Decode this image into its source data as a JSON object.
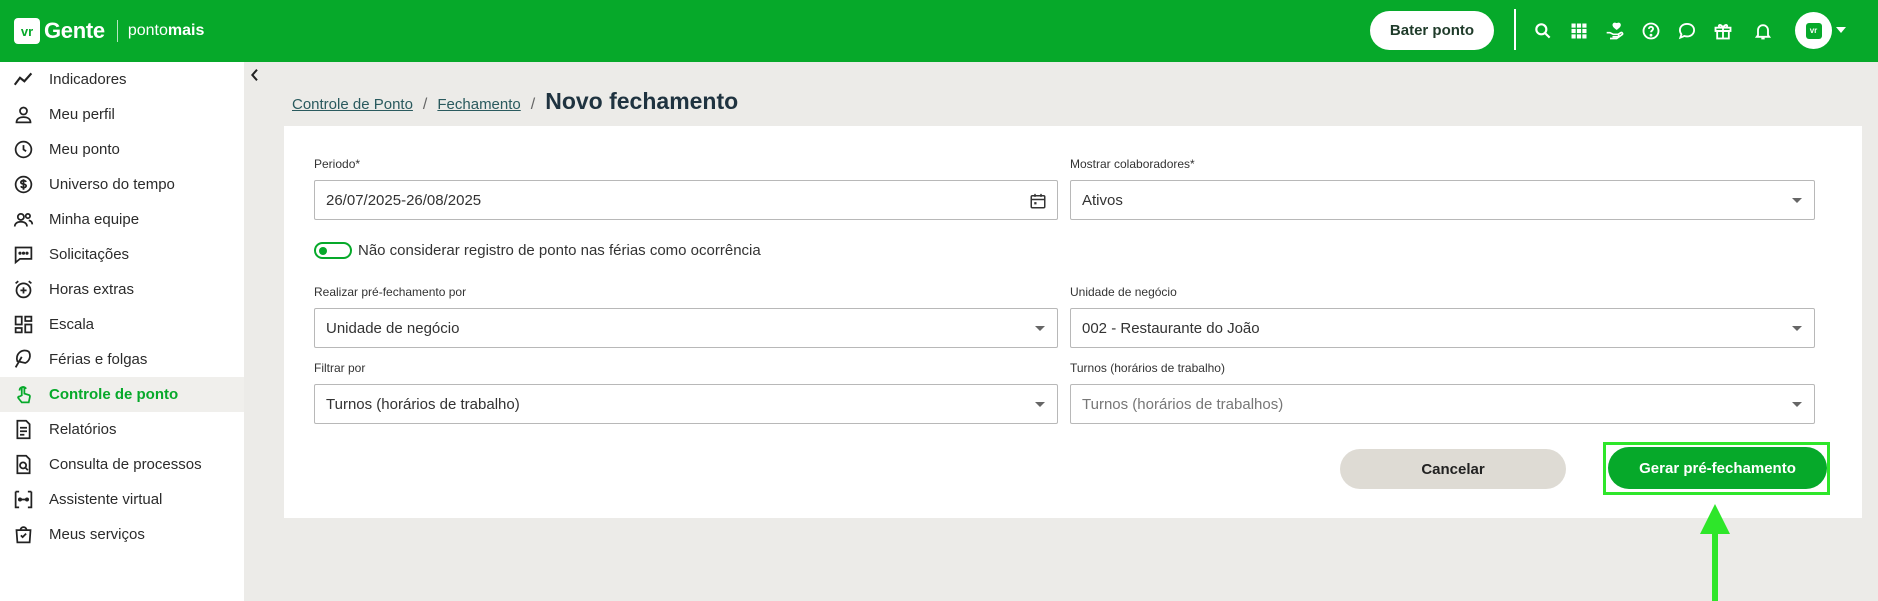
{
  "brand": {
    "badge": "vr",
    "name": "Gente",
    "product_prefix": "ponto",
    "product_suffix": "mais"
  },
  "header": {
    "clock_in_label": "Bater ponto",
    "avatar_text": "vr",
    "icons": [
      "search-icon",
      "apps-grid-icon",
      "hand-heart-icon",
      "help-icon",
      "chat-icon",
      "gift-icon",
      "bell-icon"
    ]
  },
  "sidebar": {
    "items": [
      {
        "label": "Indicadores",
        "icon": "trend-line-icon",
        "active": false
      },
      {
        "label": "Meu perfil",
        "icon": "user-icon",
        "active": false
      },
      {
        "label": "Meu ponto",
        "icon": "clock-icon",
        "active": false
      },
      {
        "label": "Universo do tempo",
        "icon": "dollar-circle-icon",
        "active": false
      },
      {
        "label": "Minha equipe",
        "icon": "team-icon",
        "active": false
      },
      {
        "label": "Solicitações",
        "icon": "message-dots-icon",
        "active": false
      },
      {
        "label": "Horas extras",
        "icon": "alarm-plus-icon",
        "active": false
      },
      {
        "label": "Escala",
        "icon": "dashboard-grid-icon",
        "active": false
      },
      {
        "label": "Férias e folgas",
        "icon": "umbrella-icon",
        "active": false
      },
      {
        "label": "Controle de ponto",
        "icon": "touch-hand-icon",
        "active": true
      },
      {
        "label": "Relatórios",
        "icon": "document-icon",
        "active": false
      },
      {
        "label": "Consulta de processos",
        "icon": "document-search-icon",
        "active": false
      },
      {
        "label": "Assistente virtual",
        "icon": "bot-icon",
        "active": false
      },
      {
        "label": "Meus serviços",
        "icon": "shopping-bag-icon",
        "active": false
      }
    ]
  },
  "breadcrumb": {
    "items": [
      "Controle de Ponto",
      "Fechamento"
    ],
    "separator": "/",
    "current": "Novo fechamento"
  },
  "form": {
    "periodo": {
      "label": "Periodo*",
      "value": "26/07/2025-26/08/2025"
    },
    "mostrar": {
      "label": "Mostrar colaboradores*",
      "value": "Ativos"
    },
    "toggle": {
      "label": "Não considerar registro de ponto nas férias como ocorrência",
      "on": true
    },
    "realizar": {
      "label": "Realizar pré-fechamento por",
      "value": "Unidade de negócio"
    },
    "unidade": {
      "label": "Unidade de negócio",
      "value": "002 - Restaurante do João"
    },
    "filtrar": {
      "label": "Filtrar por",
      "value": "Turnos (horários de trabalho)"
    },
    "turnos": {
      "label": "Turnos (horários de trabalho)",
      "placeholder": "Turnos (horários de trabalhos)"
    },
    "cancel_label": "Cancelar",
    "submit_label": "Gerar pré-fechamento"
  },
  "colors": {
    "brand_green": "#06a92a",
    "highlight": "#2ee62a",
    "background": "#ecebe8"
  }
}
